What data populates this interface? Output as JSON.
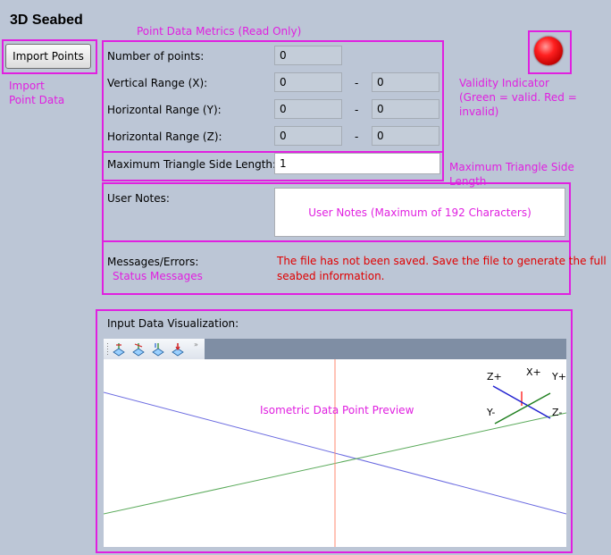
{
  "app": {
    "title": "3D Seabed"
  },
  "import": {
    "button_label": "Import Points",
    "annotation_line1": "Import",
    "annotation_line2": "Point Data"
  },
  "metrics": {
    "annotation": "Point Data Metrics (Read Only)",
    "range_separator": "-",
    "rows": [
      {
        "label": "Number of points:",
        "value": "0"
      },
      {
        "label": "Vertical Range (X):",
        "min": "0",
        "max": "0"
      },
      {
        "label": "Horizontal Range (Y):",
        "min": "0",
        "max": "0"
      },
      {
        "label": "Horizontal Range (Z):",
        "min": "0",
        "max": "0"
      }
    ]
  },
  "validity": {
    "annotation_line1": "Validity Indicator",
    "annotation_line2": "(Green = valid. Red = invalid)",
    "status_color": "#ff2020"
  },
  "triangle": {
    "label": "Maximum Triangle Side Length:",
    "value": "1",
    "annotation": "Maximum Triangle Side Length"
  },
  "notes": {
    "label": "User Notes:",
    "placeholder": "User Notes (Maximum of 192 Characters)"
  },
  "messages": {
    "label": "Messages/Errors:",
    "annotation": "Status Messages",
    "text_line1": "The file has not been saved. Save the file to generate the full",
    "text_line2": "seabed information."
  },
  "visualization": {
    "label": "Input Data Visualization:",
    "preview_annotation": "Isometric Data Point Preview",
    "axis_labels": {
      "z_plus": "Z+",
      "x_plus": "X+",
      "y_plus": "Y+",
      "y_minus": "Y-",
      "z_minus": "Z-"
    },
    "toolbar_icons": [
      "view-x-icon",
      "view-y-icon",
      "view-z-icon",
      "view-iso-icon"
    ]
  },
  "colors": {
    "annotation": "#e020e0",
    "error": "#e00000",
    "axis_x": "#ff6a50",
    "axis_y": "#3a9a3a",
    "axis_z": "#3a3ae0"
  }
}
